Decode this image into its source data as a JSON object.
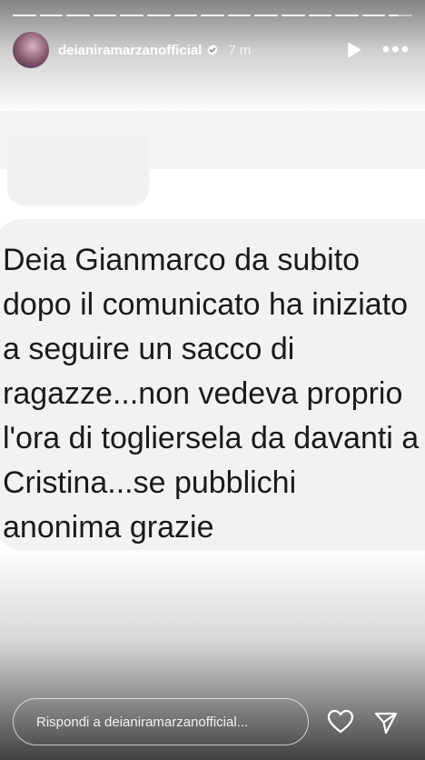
{
  "story": {
    "progress_segments": 15,
    "current_segment_progress": 0.4,
    "username": "deianiramarzanofficial",
    "verified": true,
    "time": "7 m",
    "icons": [
      "play-icon",
      "more-options-icon",
      "verified-badge-icon",
      "heart-icon",
      "send-icon"
    ]
  },
  "message": {
    "text": "Deia Gianmarco da subito dopo il comunicato ha iniziato a seguire un sacco di ragazze...non vedeva proprio l'ora di togliersela da davanti a Cristina...se pubblichi anonima grazie"
  },
  "reply": {
    "placeholder": "Rispondi a deianiramarzanofficial..."
  },
  "colors": {
    "message_bg": "#f2f2f4",
    "text": "#1a1a1a",
    "overlay_text": "#ffffff"
  }
}
